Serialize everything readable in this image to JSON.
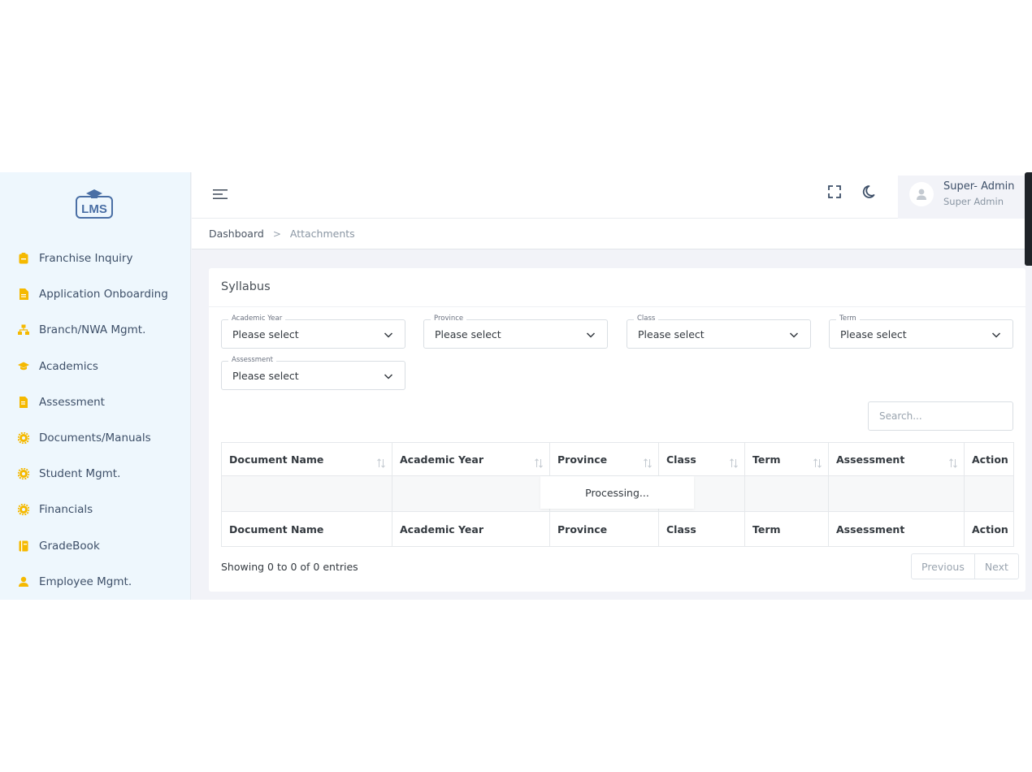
{
  "colors": {
    "accent": "#f5b900",
    "sidebar_bg": "#eef7fd",
    "logo": "#4a6fa5",
    "text": "#3d4f68"
  },
  "logo": {
    "text": "LMS"
  },
  "sidebar": {
    "items": [
      {
        "label": "Franchise Inquiry",
        "icon": "clipboard-icon"
      },
      {
        "label": "Application Onboarding",
        "icon": "file-icon"
      },
      {
        "label": "Branch/NWA Mgmt.",
        "icon": "sitemap-icon"
      },
      {
        "label": "Academics",
        "icon": "graduation-cap-icon"
      },
      {
        "label": "Assessment",
        "icon": "document-icon"
      },
      {
        "label": "Documents/Manuals",
        "icon": "gear-icon"
      },
      {
        "label": "Student Mgmt.",
        "icon": "gear-icon"
      },
      {
        "label": "Financials",
        "icon": "gear-icon"
      },
      {
        "label": "GradeBook",
        "icon": "book-icon"
      },
      {
        "label": "Employee Mgmt.",
        "icon": "user-icon"
      }
    ]
  },
  "header": {
    "user_name": "Super- Admin",
    "user_role": "Super Admin"
  },
  "breadcrumb": {
    "home": "Dashboard",
    "separator": ">",
    "current": "Attachments"
  },
  "card": {
    "title": "Syllabus",
    "filters": [
      {
        "label": "Academic Year",
        "value": "Please select"
      },
      {
        "label": "Province",
        "value": "Please select"
      },
      {
        "label": "Class",
        "value": "Please select"
      },
      {
        "label": "Term",
        "value": "Please select"
      },
      {
        "label": "Assessment",
        "value": "Please select"
      }
    ],
    "search_placeholder": "Search..."
  },
  "table": {
    "columns": [
      "Document Name",
      "Academic Year",
      "Province",
      "Class",
      "Term",
      "Assessment",
      "Action"
    ],
    "processing": "Processing...",
    "info": "Showing 0 to 0 of 0 entries",
    "pagination": {
      "previous": "Previous",
      "next": "Next"
    }
  }
}
